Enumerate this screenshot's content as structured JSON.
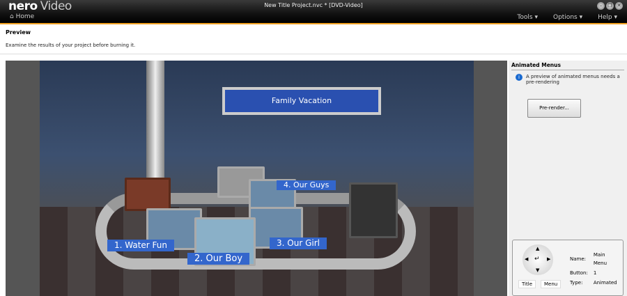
{
  "app": {
    "logo": "nero",
    "product": "Video",
    "title": "New Title Project.nvc * [DVD-Video]",
    "home": "Home",
    "menus": [
      "Tools ▾",
      "Options ▾",
      "Help ▾"
    ]
  },
  "page": {
    "title": "Preview",
    "description": "Examine the results of your project before burning it."
  },
  "preview": {
    "sign": "Family Vacation",
    "buttons": [
      "1. Water Fun",
      "2. Our Boy",
      "3. Our Girl",
      "4. Our Guys"
    ]
  },
  "panel": {
    "title": "Animated Menus",
    "info": "A preview of animated menus needs a pre-rendering",
    "prerender": "Pre-render...",
    "name_label": "Name:",
    "name": "Main Menu",
    "button_label": "Button:",
    "button": "1",
    "type_label": "Type:",
    "type": "Animated",
    "title_btn": "Title",
    "menu_btn": "Menu"
  }
}
